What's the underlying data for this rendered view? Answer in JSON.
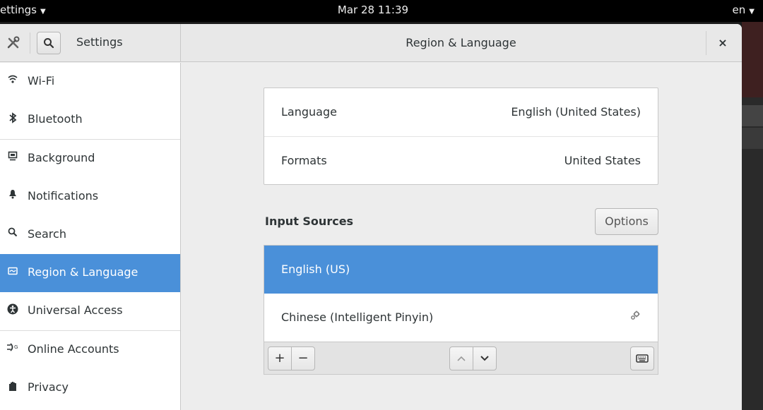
{
  "topbar": {
    "app_menu": "ettings",
    "clock": "Mar 28  11:39",
    "keyboard_layout": "en"
  },
  "window": {
    "sidebar_title": "Settings",
    "panel_title": "Region & Language",
    "close_glyph": "×"
  },
  "sidebar": {
    "items": [
      {
        "label": "Wi-Fi",
        "icon": "wifi-icon",
        "glyph": "≋"
      },
      {
        "label": "Bluetooth",
        "icon": "bluetooth-icon",
        "glyph": "✱"
      },
      {
        "label": "Background",
        "icon": "background-icon",
        "glyph": "▣"
      },
      {
        "label": "Notifications",
        "icon": "bell-icon",
        "glyph": "▲"
      },
      {
        "label": "Search",
        "icon": "search-icon",
        "glyph": "⌕"
      },
      {
        "label": "Region & Language",
        "icon": "region-icon",
        "glyph": "▬",
        "active": true
      },
      {
        "label": "Universal Access",
        "icon": "accessibility-icon",
        "glyph": "✪"
      },
      {
        "label": "Online Accounts",
        "icon": "online-accounts-icon",
        "glyph": "⇛"
      },
      {
        "label": "Privacy",
        "icon": "privacy-icon",
        "glyph": "✋"
      }
    ]
  },
  "language_panel": {
    "language_label": "Language",
    "language_value": "English (United States)",
    "formats_label": "Formats",
    "formats_value": "United States"
  },
  "input_sources": {
    "label": "Input Sources",
    "options_label": "Options",
    "sources": [
      {
        "name": "English (US)",
        "selected": true
      },
      {
        "name": "Chinese (Intelligent Pinyin)",
        "selected": false,
        "has_settings": true
      }
    ],
    "toolbar": {
      "add": "+",
      "remove": "−",
      "up": "∧",
      "down": "∨",
      "keyboard": "⌨"
    }
  },
  "colors": {
    "accent": "#4a90d9",
    "topbar": "#000000",
    "window_bg": "#ededed"
  }
}
